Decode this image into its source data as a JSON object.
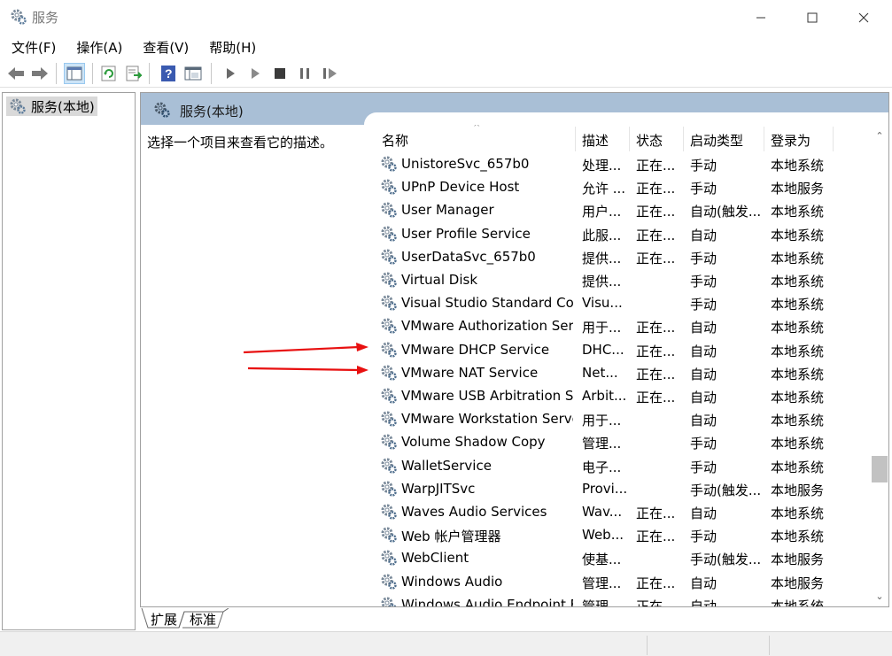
{
  "window": {
    "title": "服务",
    "icon": "gear-icon",
    "controls": [
      "minimize",
      "maximize",
      "close"
    ]
  },
  "menu": [
    "文件(F)",
    "操作(A)",
    "查看(V)",
    "帮助(H)"
  ],
  "toolbar": {
    "icons": [
      "back-arrow-icon",
      "forward-arrow-icon",
      "show-hide-tree-icon",
      "refresh-icon",
      "export-list-icon",
      "help-icon",
      "properties-icon",
      "start-service-icon",
      "start-service-alt-icon",
      "stop-service-icon",
      "pause-service-icon",
      "resume-service-icon"
    ]
  },
  "tree": {
    "root_label": "服务(本地)"
  },
  "pane": {
    "header": "服务(本地)",
    "description_prompt": "选择一个项目来查看它的描述。"
  },
  "columns": {
    "name": "名称",
    "description": "描述",
    "status": "状态",
    "startup_type": "启动类型",
    "log_on_as": "登录为"
  },
  "services": [
    {
      "name": "UnistoreSvc_657b0",
      "description": "处理...",
      "status": "正在...",
      "startup": "手动",
      "logon": "本地系统"
    },
    {
      "name": "UPnP Device Host",
      "description": "允许 ...",
      "status": "正在...",
      "startup": "手动",
      "logon": "本地服务"
    },
    {
      "name": "User Manager",
      "description": "用户...",
      "status": "正在...",
      "startup": "自动(触发...",
      "logon": "本地系统"
    },
    {
      "name": "User Profile Service",
      "description": "此服...",
      "status": "正在...",
      "startup": "自动",
      "logon": "本地系统"
    },
    {
      "name": "UserDataSvc_657b0",
      "description": "提供...",
      "status": "正在...",
      "startup": "手动",
      "logon": "本地系统"
    },
    {
      "name": "Virtual Disk",
      "description": "提供...",
      "status": "",
      "startup": "手动",
      "logon": "本地系统"
    },
    {
      "name": "Visual Studio Standard Coll...",
      "description": "Visu...",
      "status": "",
      "startup": "手动",
      "logon": "本地系统"
    },
    {
      "name": "VMware Authorization Ser...",
      "description": "用于...",
      "status": "正在...",
      "startup": "自动",
      "logon": "本地系统"
    },
    {
      "name": "VMware DHCP Service",
      "description": "DHC...",
      "status": "正在...",
      "startup": "自动",
      "logon": "本地系统"
    },
    {
      "name": "VMware NAT Service",
      "description": "Net...",
      "status": "正在...",
      "startup": "自动",
      "logon": "本地系统"
    },
    {
      "name": "VMware USB Arbitration S...",
      "description": "Arbit...",
      "status": "正在...",
      "startup": "自动",
      "logon": "本地系统"
    },
    {
      "name": "VMware Workstation Server",
      "description": "用于...",
      "status": "",
      "startup": "自动",
      "logon": "本地系统"
    },
    {
      "name": "Volume Shadow Copy",
      "description": "管理...",
      "status": "",
      "startup": "手动",
      "logon": "本地系统"
    },
    {
      "name": "WalletService",
      "description": "电子...",
      "status": "",
      "startup": "手动",
      "logon": "本地系统"
    },
    {
      "name": "WarpJITSvc",
      "description": "Provi...",
      "status": "",
      "startup": "手动(触发...",
      "logon": "本地服务"
    },
    {
      "name": "Waves Audio Services",
      "description": "Wav...",
      "status": "正在...",
      "startup": "自动",
      "logon": "本地系统"
    },
    {
      "name": "Web 帐户管理器",
      "description": "Web...",
      "status": "正在...",
      "startup": "手动",
      "logon": "本地系统"
    },
    {
      "name": "WebClient",
      "description": "使基...",
      "status": "",
      "startup": "手动(触发...",
      "logon": "本地服务"
    },
    {
      "name": "Windows Audio",
      "description": "管理...",
      "status": "正在...",
      "startup": "自动",
      "logon": "本地服务"
    },
    {
      "name": "Windows Audio Endpoint B...",
      "description": "管理...",
      "status": "正在...",
      "startup": "自动",
      "logon": "本地系统"
    }
  ],
  "tabs": [
    "扩展",
    "标准"
  ],
  "annotation_color": "#e81010",
  "accent_header_color": "#a9bfd6"
}
